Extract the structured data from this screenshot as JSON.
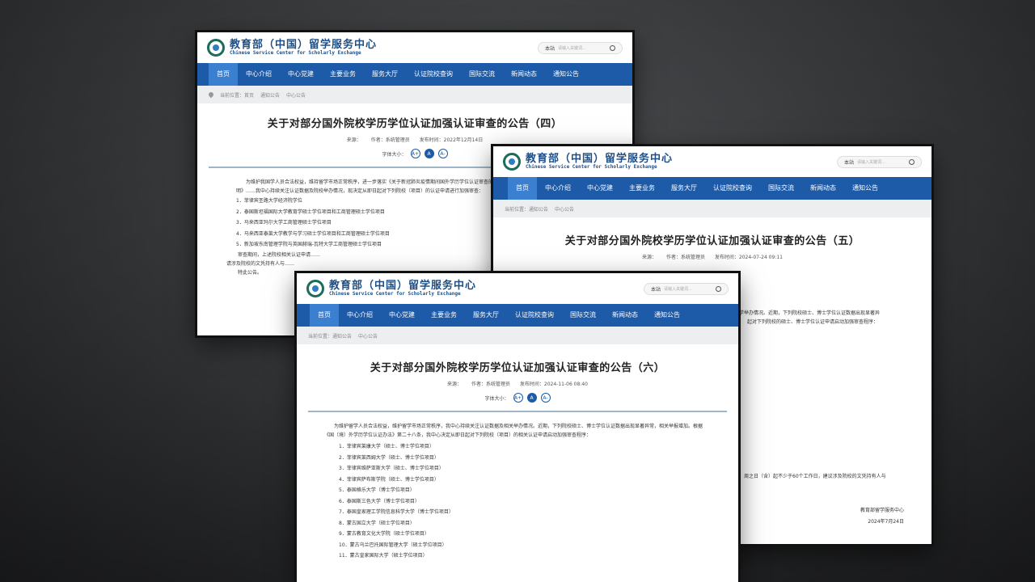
{
  "site": {
    "brand_cn": "教育部（中国）留学服务中心",
    "brand_en": "Chinese Service Center for Scholarly Exchange",
    "search_scope": "本站",
    "search_placeholder": "请输入关键词...",
    "nav": [
      "首页",
      "中心介绍",
      "中心党建",
      "主要业务",
      "服务大厅",
      "认证院校查询",
      "国际交流",
      "新闻动态",
      "通知公告"
    ],
    "crumb": [
      "当前位置：首页",
      "通知公告",
      "中心公告"
    ],
    "font_label": "字体大小：",
    "font_buttons": [
      "A+",
      "A",
      "A-"
    ]
  },
  "win4": {
    "title": "关于对部分国外院校学历学位认证加强认证审查的公告（四）",
    "source": "来源：",
    "author": "作者：系统管理员",
    "time": "发布时间：2022年12月14日",
    "para": "为维护我国学人员合法权益，维持留学市场正常秩序，进一步落实《关于新冠肺炎疫情期间国外学历学位认证审查的相关说明》……我中心持续关注认证数据及院校举办情况，现决定从即日起对下列院校（项目）的认证申请进行加强审查：",
    "items": [
      "1．菲律宾圣路大学经济院学位",
      "2．泰国斯坦福国际大学教育学硕士学位项目和工商管理硕士学位项目",
      "3．马来西亚玛尔大学工商管理硕士学位项目",
      "4．马来西亚泰莱大学教学与学习硕士学位项目和工商管理硕士学位项目",
      "5．新加坡东南管理学院与英国赫瑞-瓦特大学工商管理硕士学位项目"
    ],
    "tail1": "审查期间，上述院校相关认证申请……",
    "tail2": "请涉及院校的文凭持有人与……",
    "tail3": "特此公告。"
  },
  "win5": {
    "crumb": "当前位置：通知公告",
    "title": "关于对部分国外院校学历学位认证加强认证审查的公告（五）",
    "source": "来源：",
    "author": "作者：系统管理员",
    "time": "发布时间：2024-07-24 09:11",
    "frag1": "学举办情况。近期，下列院校硕士、博士学位认证数据出现显著异",
    "frag2": "起对下列院校的硕士、博士学位认证申请启动加强审查程序：",
    "frag3": "周之日（含）起不少于60个工作日，建议涉及院校的文凭持有人与",
    "sign": "教育部留学服务中心",
    "date": "2024年7月24日"
  },
  "win6": {
    "title": "关于对部分国外院校学历学位认证加强认证审查的公告（六）",
    "source": "来源：",
    "author": "作者：系统管理员",
    "time": "发布时间：2024-11-06 08:40",
    "para": "为维护留学人员合法权益，维护留学市场正常秩序，我中心持续关注认证数据及相关举办情况。近期，下列院校硕士、博士学位认证数据出现显著异常，相关举报增加。根据《国（境）外学历学位认证办法》第二十八条，我中心决定从即日起对下列院校（项目）的相关认证申请启动加强审查程序：",
    "items": [
      "1．菲律宾莱康大学（硕士、博士学位项目）",
      "2．菲律宾莱西姆大学（硕士、博士学位项目）",
      "3．菲律宾维萨亚斯大学（硕士、博士学位项目）",
      "4．菲律宾萨布斯学院（硕士、博士学位项目）",
      "5．泰国格乐大学（博士学位项目）",
      "6．泰国斯三色大学（博士学位项目）",
      "7．泰国皇家理工学院信息科学大学（博士学位项目）",
      "8．蒙古国立大学（硕士学位项目）",
      "9．蒙古教育文化大学院（硕士学位项目）",
      "10．蒙古乌兰巴托国际管理大学（硕士学位项目）",
      "11．蒙古皇家国际大学（硕士学位项目）"
    ]
  }
}
